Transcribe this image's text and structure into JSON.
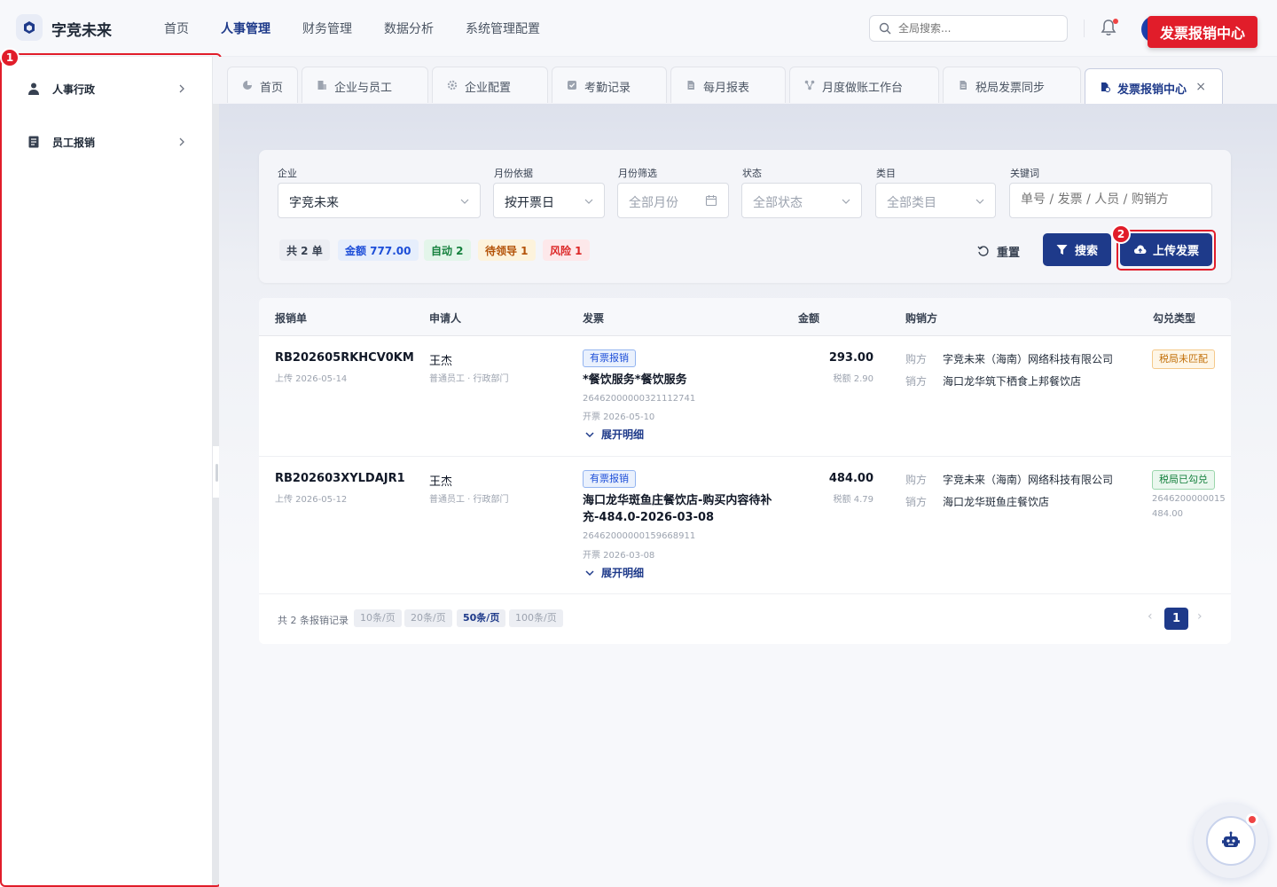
{
  "app": {
    "brand": "字竞未来",
    "callout_title": "发票报销中心"
  },
  "nav": {
    "items": [
      "首页",
      "人事管理",
      "财务管理",
      "数据分析",
      "系统管理配置"
    ],
    "active_index": 1
  },
  "search": {
    "placeholder": "全局搜索..."
  },
  "sidebar": {
    "items": [
      {
        "label": "人事行政",
        "icon": "user-icon"
      },
      {
        "label": "员工报销",
        "icon": "receipt-icon"
      }
    ]
  },
  "annotations": {
    "badge1": "1",
    "badge2": "2"
  },
  "tabs": [
    {
      "label": "首页",
      "icon": "pie-chart-icon"
    },
    {
      "label": "企业与员工",
      "icon": "building-icon"
    },
    {
      "label": "企业配置",
      "icon": "gear-icon"
    },
    {
      "label": "考勤记录",
      "icon": "check-square-icon"
    },
    {
      "label": "每月报表",
      "icon": "file-icon"
    },
    {
      "label": "月度做账工作台",
      "icon": "network-icon"
    },
    {
      "label": "税局发票同步",
      "icon": "file-icon"
    },
    {
      "label": "发票报销中心",
      "icon": "invoice-icon",
      "active": true,
      "close": "×"
    }
  ],
  "filters": {
    "company": {
      "label": "企业",
      "value": "字竞未来"
    },
    "month_basis": {
      "label": "月份依据",
      "value": "按开票日"
    },
    "month_filter": {
      "label": "月份筛选",
      "placeholder": "全部月份"
    },
    "status": {
      "label": "状态",
      "placeholder": "全部状态"
    },
    "category": {
      "label": "类目",
      "placeholder": "全部类目"
    },
    "keyword": {
      "label": "关键词",
      "placeholder": "单号 / 发票 / 人员 / 购销方"
    }
  },
  "summary": {
    "total": "共 2 单",
    "amount": "金额 777.00",
    "auto": "自动 2",
    "pending": "待领导 1",
    "risk": "风险 1"
  },
  "actions": {
    "reset": "重置",
    "search": "搜索",
    "upload": "上传发票"
  },
  "table": {
    "headers": [
      "报销单",
      "申请人",
      "发票",
      "金额",
      "购销方",
      "勾兑类型"
    ],
    "rows": [
      {
        "no": "RB202605RKHCV0KM",
        "uploaded": "上传 2026-05-14",
        "applicant": "王杰",
        "dept": "普通员工 · 行政部门",
        "inv_tag": "有票报销",
        "inv_title": "*餐饮服务*餐饮服务",
        "inv_no": "26462000000321112741",
        "inv_date": "开票 2026-05-10",
        "expand": "展开明细",
        "amount": "293.00",
        "tax": "税额 2.90",
        "buyer_label": "购方",
        "buyer": "字竞未来（海南）网络科技有限公司",
        "seller_label": "销方",
        "seller": "海口龙华筑下栖食上邦餐饮店",
        "match": "税局未匹配",
        "match_type": "warn"
      },
      {
        "no": "RB202603XYLDAJR1",
        "uploaded": "上传 2026-05-12",
        "applicant": "王杰",
        "dept": "普通员工 · 行政部门",
        "inv_tag": "有票报销",
        "inv_title": "海口龙华斑鱼庄餐饮店-购买内容待补充-484.0-2026-03-08",
        "inv_no": "26462000000159668911",
        "inv_date": "开票 2026-03-08",
        "expand": "展开明细",
        "amount": "484.00",
        "tax": "税额 4.79",
        "buyer_label": "购方",
        "buyer": "字竞未来（海南）网络科技有限公司",
        "seller_label": "销方",
        "seller": "海口龙华斑鱼庄餐饮店",
        "match": "税局已勾兑",
        "match_type": "ok",
        "match_no": "2646200000015",
        "match_amt": "484.00"
      }
    ]
  },
  "pager": {
    "total": "共 2 条报销记录",
    "sizes": [
      "10条/页",
      "20条/页",
      "50条/页",
      "100条/页"
    ],
    "active_size_index": 2,
    "current_page": "1",
    "prev": "‹",
    "next": "›"
  },
  "colors": {
    "primary": "#1e3a8a",
    "callout": "#e11d2a"
  }
}
